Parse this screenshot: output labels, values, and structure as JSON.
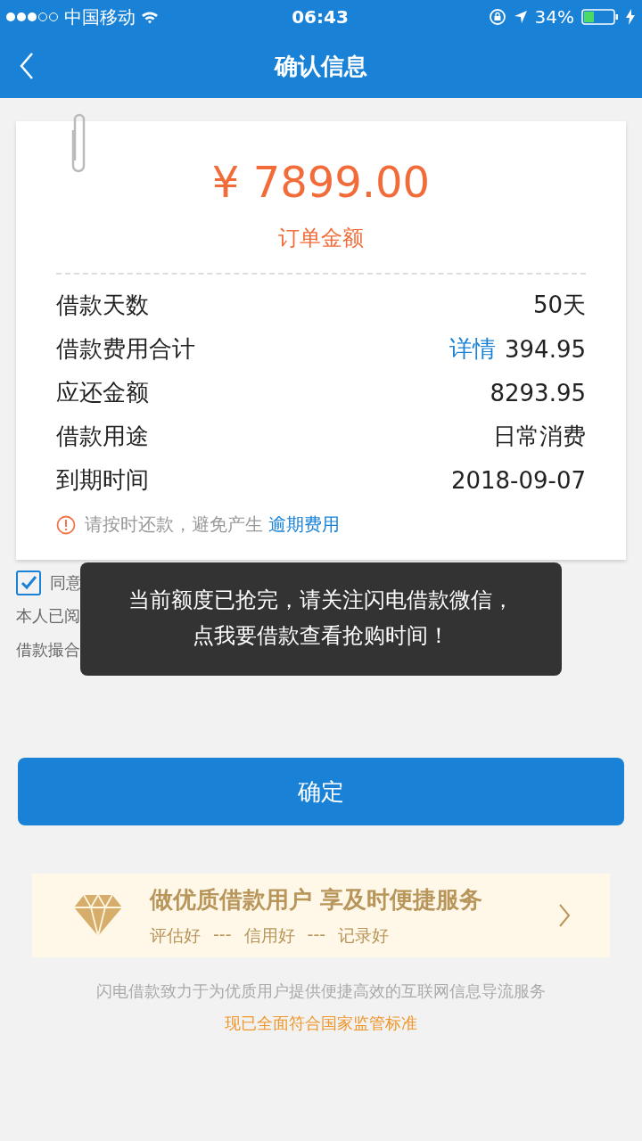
{
  "status_bar": {
    "carrier": "中国移动",
    "time": "06:43",
    "battery": "34%"
  },
  "nav": {
    "title": "确认信息"
  },
  "order": {
    "amount": "¥ 7899.00",
    "amount_label": "订单金额",
    "rows": [
      {
        "label": "借款天数",
        "value": "50天"
      },
      {
        "label": "借款费用合计",
        "link": "详情",
        "value": "394.95"
      },
      {
        "label": "应还金额",
        "value": "8293.95"
      },
      {
        "label": "借款用途",
        "value": "日常消费"
      },
      {
        "label": "到期时间",
        "value": "2018-09-07"
      }
    ],
    "notice": {
      "text": "请按时还款，避免产生",
      "link": "逾期费用"
    }
  },
  "agreement": {
    "checked": true,
    "label": "同意",
    "lines": [
      "本人已阅",
      "借款撮合"
    ]
  },
  "confirm_button": "确定",
  "banner": {
    "title": "做优质借款用户 享及时便捷服务",
    "tags": [
      "评估好",
      "---",
      "信用好",
      "---",
      "记录好"
    ]
  },
  "footer": {
    "line": "闪电借款致力于为优质用户提供便捷高效的互联网信息导流服务",
    "highlight": "现已全面符合国家监管标准"
  },
  "toast": {
    "text": "当前额度已抢完，请关注闪电借款微信，点我要借款查看抢购时间！"
  }
}
